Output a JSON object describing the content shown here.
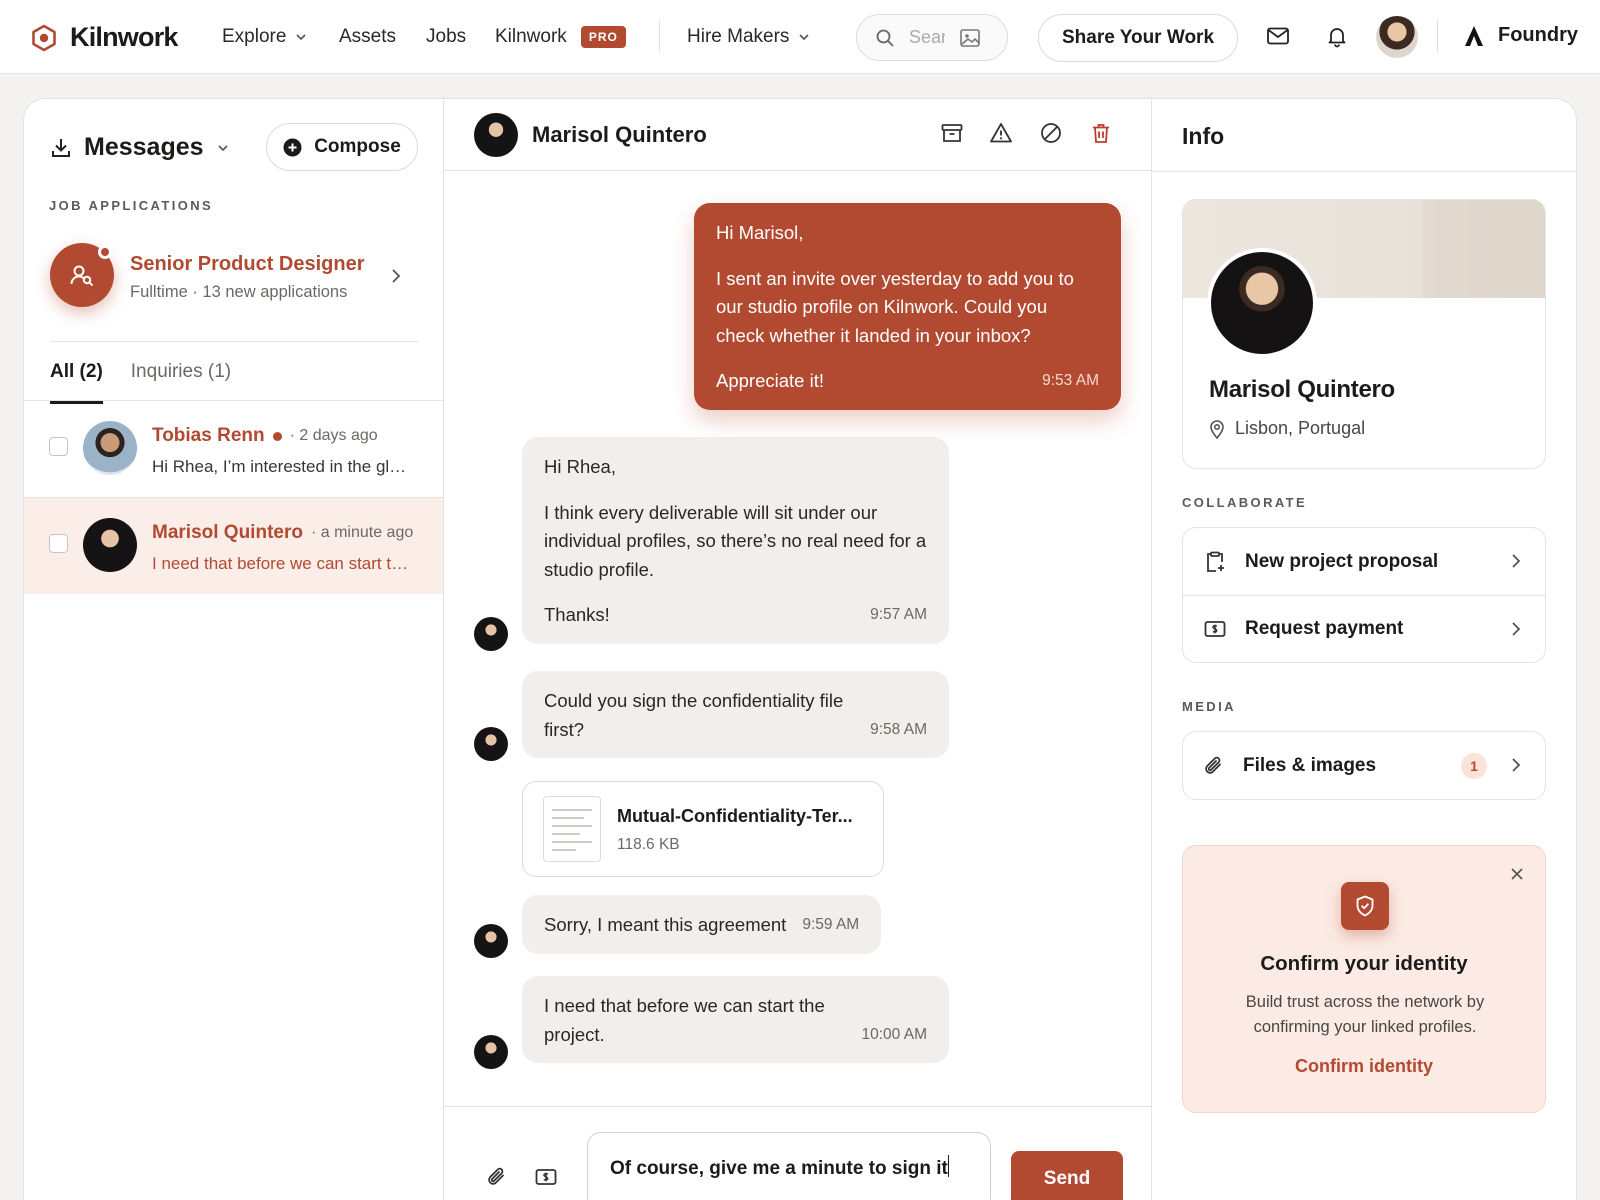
{
  "topbar": {
    "logo_text": "Kilnwork",
    "nav": [
      {
        "label": "Explore"
      },
      {
        "label": "Assets"
      },
      {
        "label": "Jobs"
      },
      {
        "label": "Kilnwork"
      },
      {
        "label": "Hire Makers"
      }
    ],
    "pro_badge": "PRO",
    "search_placeholder": "Search",
    "share_button": "Share Your Work",
    "workspace": "Foundry"
  },
  "sidebar": {
    "title": "Messages",
    "compose_label": "Compose",
    "section_label": "JOB APPLICATIONS",
    "job": {
      "title": "Senior Product Designer",
      "subtitle": "Fulltime · 13 new applications"
    },
    "tabs": [
      {
        "label": "All (2)"
      },
      {
        "label": "Inquiries (1)"
      }
    ],
    "conversations": [
      {
        "name": "Tobias Renn",
        "time": "· 2 days ago",
        "preview": "Hi Rhea, I’m interested in the global design role"
      },
      {
        "name": "Marisol Quintero",
        "time": "· a minute ago",
        "preview": "I need that before we can start the project."
      }
    ]
  },
  "chat": {
    "contact_name": "Marisol Quintero",
    "messages": [
      {
        "p1": "Hi Marisol,",
        "p2": "I sent an invite over yesterday to add you to our studio profile on Kilnwork. Could you check whether it landed in your inbox?",
        "last": "Appreciate it!",
        "time": "9:53 AM"
      },
      {
        "p1": "Hi Rhea,",
        "p2": "I think every deliverable will sit under our individual profiles, so there’s no real need for a studio profile.",
        "last": "Thanks!",
        "time": "9:57 AM"
      },
      {
        "text": "Could you sign the confidentiality file first?",
        "time": "9:58 AM"
      },
      {
        "text": "Sorry, I meant this agreement",
        "time": "9:59 AM"
      },
      {
        "text": "I need that before we can start the project.",
        "time": "10:00 AM"
      }
    ],
    "file": {
      "name": "Mutual-Confidentiality-Ter...",
      "size": "118.6 KB"
    },
    "draft": "Of course, give me a minute to sign it",
    "send_label": "Send"
  },
  "info": {
    "title": "Info",
    "profile_name": "Marisol Quintero",
    "location": "Lisbon, Portugal",
    "collaborate_label": "COLLABORATE",
    "actions": [
      {
        "label": "New project proposal"
      },
      {
        "label": "Request payment"
      }
    ],
    "media_label": "MEDIA",
    "media": {
      "label": "Files & images",
      "count": "1"
    },
    "identity": {
      "title": "Confirm your identity",
      "description": "Build trust across the network by confirming your linked profiles.",
      "link": "Confirm identity"
    }
  },
  "colors": {
    "accent": "#b24a32",
    "accent_soft": "#fbebe4",
    "bubble_in": "#f1eeeb"
  }
}
